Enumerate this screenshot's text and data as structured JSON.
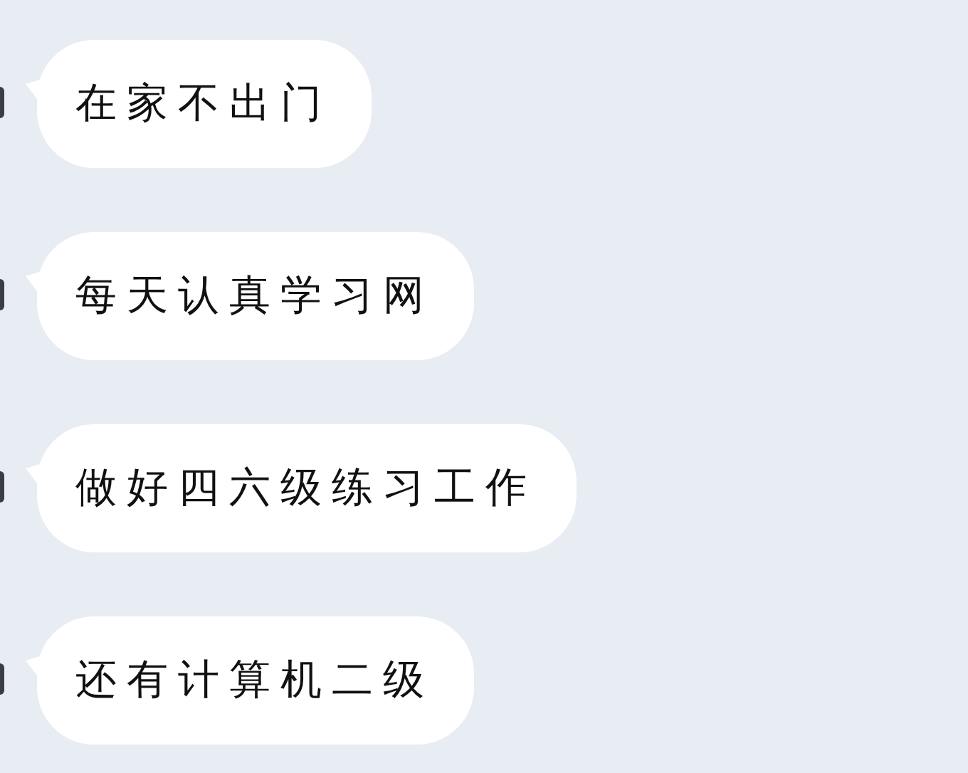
{
  "messages": [
    {
      "text": "在家不出门"
    },
    {
      "text": "每天认真学习网"
    },
    {
      "text": "做好四六级练习工作"
    },
    {
      "text": "还有计算机二级"
    }
  ]
}
